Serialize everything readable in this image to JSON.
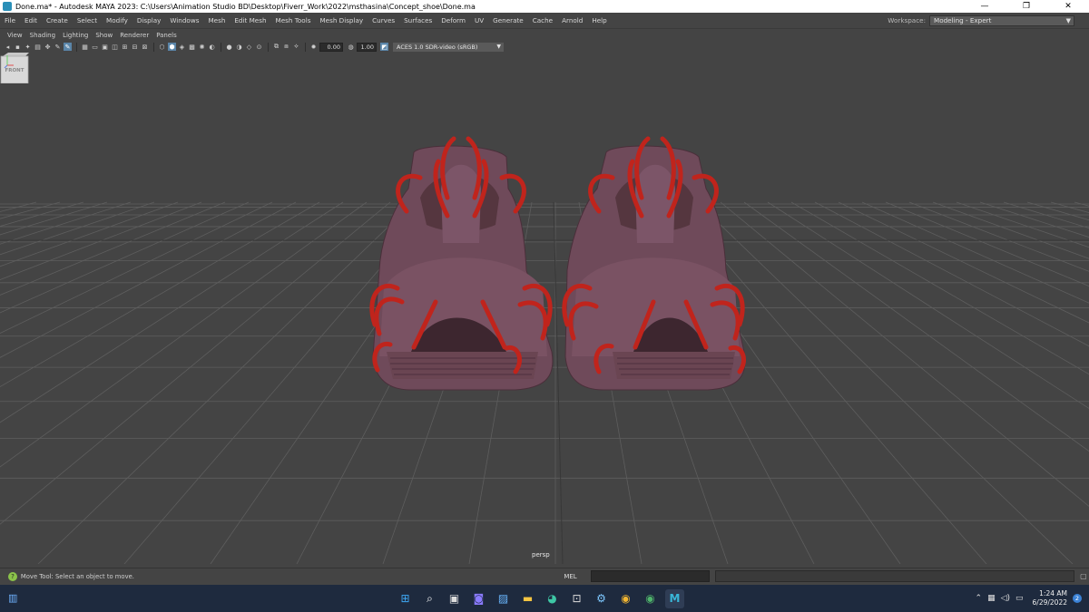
{
  "window": {
    "title": "Done.ma* - Autodesk MAYA 2023: C:\\Users\\Animation Studio BD\\Desktop\\Fiverr_Work\\2022\\msthasina\\Concept_shoe\\Done.ma",
    "minimize": "—",
    "restore": "❐",
    "close": "✕"
  },
  "menubar": {
    "items": [
      "File",
      "Edit",
      "Create",
      "Select",
      "Modify",
      "Display",
      "Windows",
      "Mesh",
      "Edit Mesh",
      "Mesh Tools",
      "Mesh Display",
      "Curves",
      "Surfaces",
      "Deform",
      "UV",
      "Generate",
      "Cache",
      "Arnold",
      "Help"
    ],
    "workspace_label": "Workspace:",
    "workspace_value": "Modeling - Expert"
  },
  "panel_menu": {
    "items": [
      "View",
      "Shading",
      "Lighting",
      "Show",
      "Renderer",
      "Panels"
    ]
  },
  "panel_toolbar": {
    "exposure": "0.00",
    "gamma": "1.00",
    "color_space": "ACES 1.0 SDR-video (sRGB)"
  },
  "viewport": {
    "camera_label": "persp",
    "viewcube_label": "FRONT",
    "background_color": "#444444",
    "grid_color": "#5c5c5c",
    "shoe_body_color": "#6f4a5a",
    "shoe_strap_color": "#c0241c"
  },
  "status": {
    "help_text": "Move Tool: Select an object to move.",
    "mel_label": "MEL"
  },
  "taskbar": {
    "time": "1:24 AM",
    "date": "6/29/2022",
    "notification_count": "2",
    "apps": [
      "windows-start",
      "search",
      "file-explorer-task",
      "teams",
      "photos",
      "file-explorer",
      "edge",
      "store",
      "settings",
      "chrome",
      "chrome-alt",
      "maya"
    ]
  }
}
